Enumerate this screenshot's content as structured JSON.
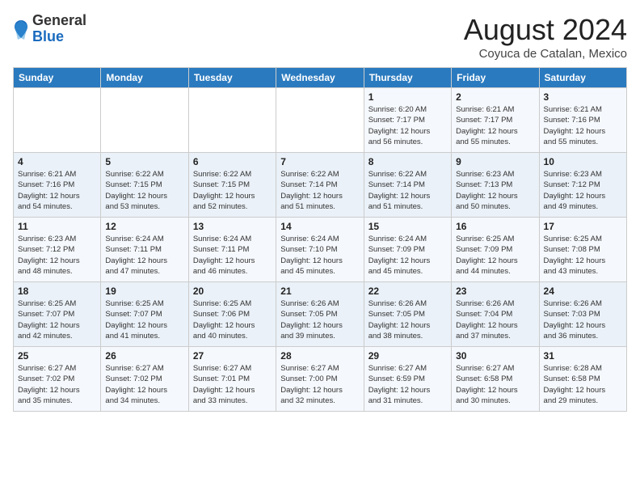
{
  "header": {
    "logo_general": "General",
    "logo_blue": "Blue",
    "month_title": "August 2024",
    "subtitle": "Coyuca de Catalan, Mexico"
  },
  "weekdays": [
    "Sunday",
    "Monday",
    "Tuesday",
    "Wednesday",
    "Thursday",
    "Friday",
    "Saturday"
  ],
  "weeks": [
    [
      {
        "day": "",
        "info": ""
      },
      {
        "day": "",
        "info": ""
      },
      {
        "day": "",
        "info": ""
      },
      {
        "day": "",
        "info": ""
      },
      {
        "day": "1",
        "info": "Sunrise: 6:20 AM\nSunset: 7:17 PM\nDaylight: 12 hours\nand 56 minutes."
      },
      {
        "day": "2",
        "info": "Sunrise: 6:21 AM\nSunset: 7:17 PM\nDaylight: 12 hours\nand 55 minutes."
      },
      {
        "day": "3",
        "info": "Sunrise: 6:21 AM\nSunset: 7:16 PM\nDaylight: 12 hours\nand 55 minutes."
      }
    ],
    [
      {
        "day": "4",
        "info": "Sunrise: 6:21 AM\nSunset: 7:16 PM\nDaylight: 12 hours\nand 54 minutes."
      },
      {
        "day": "5",
        "info": "Sunrise: 6:22 AM\nSunset: 7:15 PM\nDaylight: 12 hours\nand 53 minutes."
      },
      {
        "day": "6",
        "info": "Sunrise: 6:22 AM\nSunset: 7:15 PM\nDaylight: 12 hours\nand 52 minutes."
      },
      {
        "day": "7",
        "info": "Sunrise: 6:22 AM\nSunset: 7:14 PM\nDaylight: 12 hours\nand 51 minutes."
      },
      {
        "day": "8",
        "info": "Sunrise: 6:22 AM\nSunset: 7:14 PM\nDaylight: 12 hours\nand 51 minutes."
      },
      {
        "day": "9",
        "info": "Sunrise: 6:23 AM\nSunset: 7:13 PM\nDaylight: 12 hours\nand 50 minutes."
      },
      {
        "day": "10",
        "info": "Sunrise: 6:23 AM\nSunset: 7:12 PM\nDaylight: 12 hours\nand 49 minutes."
      }
    ],
    [
      {
        "day": "11",
        "info": "Sunrise: 6:23 AM\nSunset: 7:12 PM\nDaylight: 12 hours\nand 48 minutes."
      },
      {
        "day": "12",
        "info": "Sunrise: 6:24 AM\nSunset: 7:11 PM\nDaylight: 12 hours\nand 47 minutes."
      },
      {
        "day": "13",
        "info": "Sunrise: 6:24 AM\nSunset: 7:11 PM\nDaylight: 12 hours\nand 46 minutes."
      },
      {
        "day": "14",
        "info": "Sunrise: 6:24 AM\nSunset: 7:10 PM\nDaylight: 12 hours\nand 45 minutes."
      },
      {
        "day": "15",
        "info": "Sunrise: 6:24 AM\nSunset: 7:09 PM\nDaylight: 12 hours\nand 45 minutes."
      },
      {
        "day": "16",
        "info": "Sunrise: 6:25 AM\nSunset: 7:09 PM\nDaylight: 12 hours\nand 44 minutes."
      },
      {
        "day": "17",
        "info": "Sunrise: 6:25 AM\nSunset: 7:08 PM\nDaylight: 12 hours\nand 43 minutes."
      }
    ],
    [
      {
        "day": "18",
        "info": "Sunrise: 6:25 AM\nSunset: 7:07 PM\nDaylight: 12 hours\nand 42 minutes."
      },
      {
        "day": "19",
        "info": "Sunrise: 6:25 AM\nSunset: 7:07 PM\nDaylight: 12 hours\nand 41 minutes."
      },
      {
        "day": "20",
        "info": "Sunrise: 6:25 AM\nSunset: 7:06 PM\nDaylight: 12 hours\nand 40 minutes."
      },
      {
        "day": "21",
        "info": "Sunrise: 6:26 AM\nSunset: 7:05 PM\nDaylight: 12 hours\nand 39 minutes."
      },
      {
        "day": "22",
        "info": "Sunrise: 6:26 AM\nSunset: 7:05 PM\nDaylight: 12 hours\nand 38 minutes."
      },
      {
        "day": "23",
        "info": "Sunrise: 6:26 AM\nSunset: 7:04 PM\nDaylight: 12 hours\nand 37 minutes."
      },
      {
        "day": "24",
        "info": "Sunrise: 6:26 AM\nSunset: 7:03 PM\nDaylight: 12 hours\nand 36 minutes."
      }
    ],
    [
      {
        "day": "25",
        "info": "Sunrise: 6:27 AM\nSunset: 7:02 PM\nDaylight: 12 hours\nand 35 minutes."
      },
      {
        "day": "26",
        "info": "Sunrise: 6:27 AM\nSunset: 7:02 PM\nDaylight: 12 hours\nand 34 minutes."
      },
      {
        "day": "27",
        "info": "Sunrise: 6:27 AM\nSunset: 7:01 PM\nDaylight: 12 hours\nand 33 minutes."
      },
      {
        "day": "28",
        "info": "Sunrise: 6:27 AM\nSunset: 7:00 PM\nDaylight: 12 hours\nand 32 minutes."
      },
      {
        "day": "29",
        "info": "Sunrise: 6:27 AM\nSunset: 6:59 PM\nDaylight: 12 hours\nand 31 minutes."
      },
      {
        "day": "30",
        "info": "Sunrise: 6:27 AM\nSunset: 6:58 PM\nDaylight: 12 hours\nand 30 minutes."
      },
      {
        "day": "31",
        "info": "Sunrise: 6:28 AM\nSunset: 6:58 PM\nDaylight: 12 hours\nand 29 minutes."
      }
    ]
  ]
}
